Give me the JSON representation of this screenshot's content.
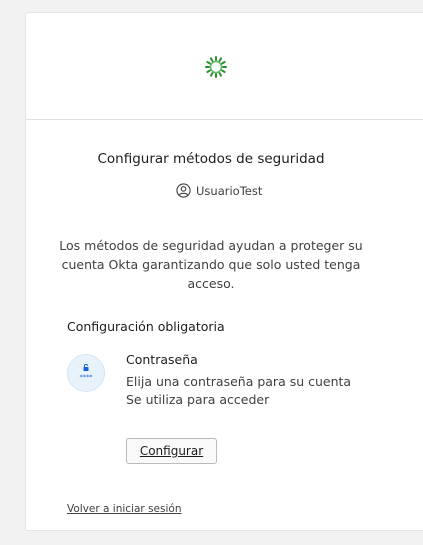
{
  "header": {
    "logo_icon": "okta-sunburst-logo",
    "logo_color": "#2e8b2e"
  },
  "main": {
    "title": "Configurar métodos de seguridad",
    "user_icon": "user-circle-icon",
    "username": "UsuarioTest",
    "description": "Los métodos de seguridad ayudan a proteger su cuenta Okta garantizando que solo usted tenga acceso.",
    "section_title": "Configuración obligatoria"
  },
  "authenticator": {
    "icon": "password-lock-icon",
    "icon_color": "#1662dd",
    "name": "Contraseña",
    "description_line1": "Elija una contraseña para su cuenta",
    "description_line2": "Se utiliza para acceder",
    "button_label": "Configurar"
  },
  "footer": {
    "back_link": "Volver a iniciar sesión"
  }
}
